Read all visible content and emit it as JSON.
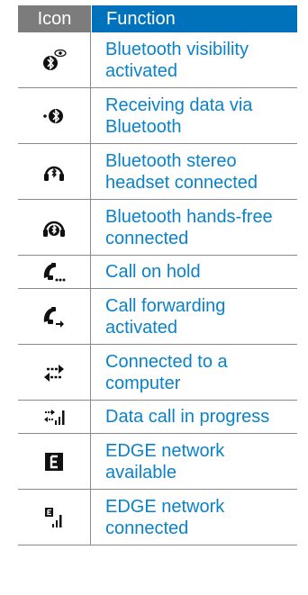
{
  "header": {
    "icon_col": "Icon",
    "function_col": "Function"
  },
  "rows": [
    {
      "icon": "bluetooth-visibility-icon",
      "label": "Bluetooth visibility activated"
    },
    {
      "icon": "bluetooth-receiving-icon",
      "label": "Receiving data via Bluetooth"
    },
    {
      "icon": "bluetooth-stereo-headset-icon",
      "label": "Bluetooth stereo headset connected"
    },
    {
      "icon": "bluetooth-handsfree-icon",
      "label": "Bluetooth hands-free connected"
    },
    {
      "icon": "call-on-hold-icon",
      "label": "Call on hold"
    },
    {
      "icon": "call-forwarding-icon",
      "label": "Call forwarding activated"
    },
    {
      "icon": "computer-connected-icon",
      "label": "Connected to a computer"
    },
    {
      "icon": "data-call-icon",
      "label": "Data call in progress"
    },
    {
      "icon": "edge-available-icon",
      "label": "EDGE network available"
    },
    {
      "icon": "edge-connected-icon",
      "label": "EDGE network connected"
    }
  ],
  "colors": {
    "header_gray": "#7c7c7c",
    "header_blue": "#0072bc",
    "text_blue": "#0a82c8"
  }
}
